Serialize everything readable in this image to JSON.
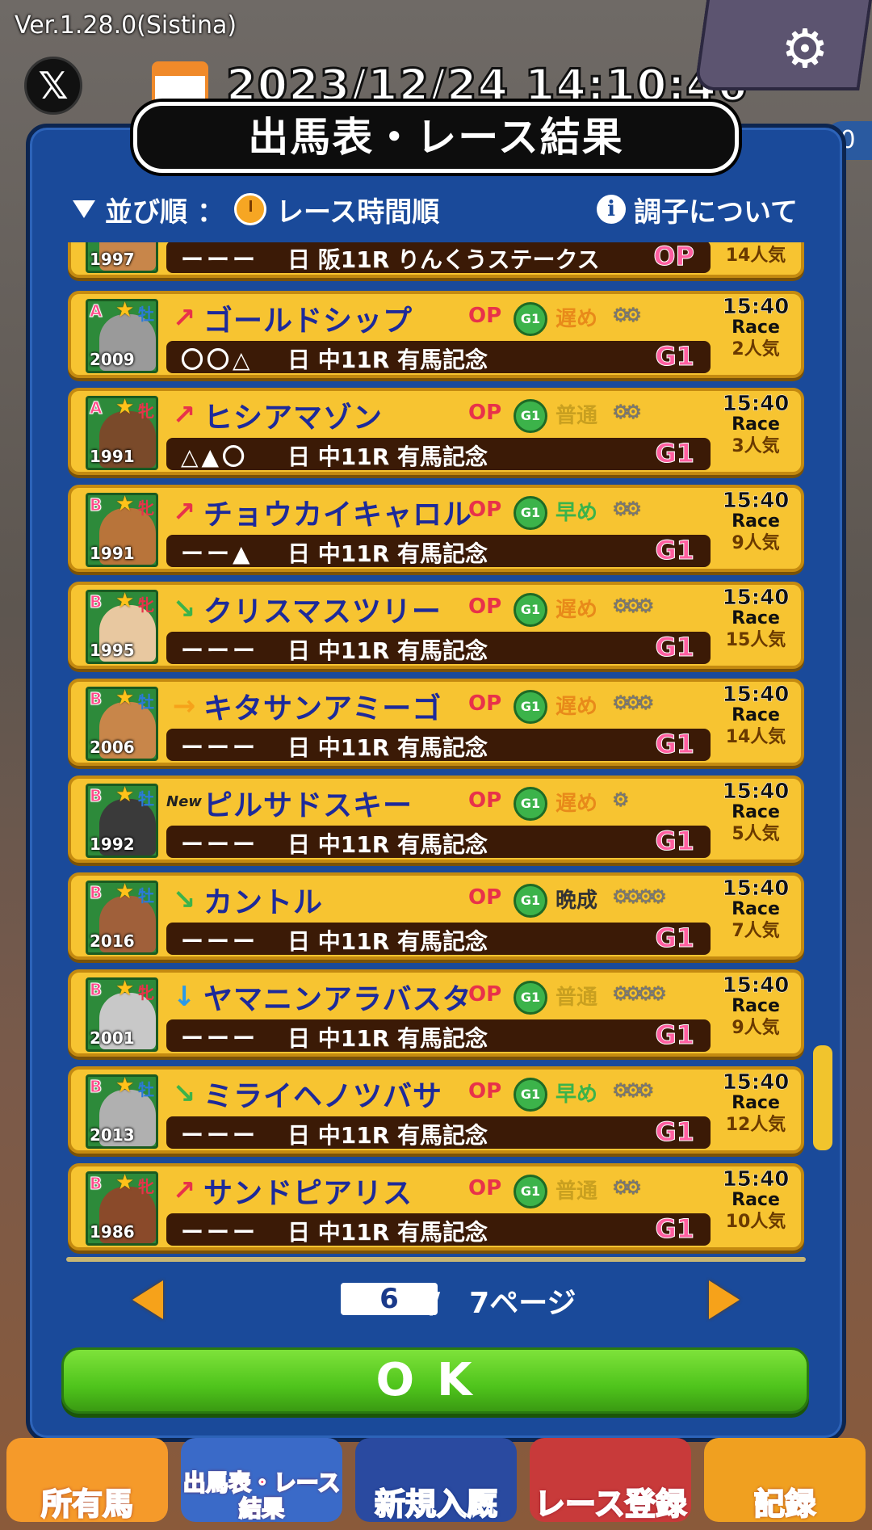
{
  "app": {
    "version": "Ver.1.28.0(Sistina)",
    "datetime": "2023/12/24 14:10:46",
    "x_label": "𝕏",
    "right_pill": "0"
  },
  "dialog": {
    "title": "出馬表・レース結果",
    "sort_prefix": "並び順",
    "sort_colon": "：",
    "sort_value": "レース時間順",
    "condition_link": "調子について"
  },
  "rows": [
    {
      "year": "2009",
      "grade": "A",
      "sex": "牡",
      "sex_color": "#2a7ad8",
      "trend": "↗",
      "trend_color": "#e8324a",
      "new": "",
      "name": "ゴールドシップ",
      "op": "OP",
      "g1": "G1",
      "growth": "遅め",
      "growth_color": "#e88a1a",
      "shoes": "⚙⚙",
      "marks": "〇〇△",
      "day": "日",
      "race": "中11R 有馬記念",
      "race_grade": "G1",
      "time": "15:40",
      "race_tag": "Race",
      "pop": "2人気",
      "coat": "#9a9a9a"
    },
    {
      "year": "1991",
      "grade": "A",
      "sex": "牝",
      "sex_color": "#e8324a",
      "trend": "↗",
      "trend_color": "#e8324a",
      "new": "",
      "name": "ヒシアマゾン",
      "op": "OP",
      "g1": "G1",
      "growth": "普通",
      "growth_color": "#c9a020",
      "shoes": "⚙⚙",
      "marks": "△▲〇",
      "day": "日",
      "race": "中11R 有馬記念",
      "race_grade": "G1",
      "time": "15:40",
      "race_tag": "Race",
      "pop": "3人気",
      "coat": "#7a4a2a"
    },
    {
      "year": "1991",
      "grade": "B",
      "sex": "牝",
      "sex_color": "#e8324a",
      "trend": "↗",
      "trend_color": "#e8324a",
      "new": "",
      "name": "チョウカイキャロル",
      "op": "OP",
      "g1": "G1",
      "growth": "早め",
      "growth_color": "#3cb34a",
      "shoes": "⚙⚙",
      "marks": "ーー▲",
      "day": "日",
      "race": "中11R 有馬記念",
      "race_grade": "G1",
      "time": "15:40",
      "race_tag": "Race",
      "pop": "9人気",
      "coat": "#b8743a"
    },
    {
      "year": "1995",
      "grade": "B",
      "sex": "牝",
      "sex_color": "#e8324a",
      "trend": "↘",
      "trend_color": "#3cb34a",
      "new": "",
      "name": "クリスマスツリー",
      "op": "OP",
      "g1": "G1",
      "growth": "遅め",
      "growth_color": "#e88a1a",
      "shoes": "⚙⚙⚙",
      "marks": "ーーー",
      "day": "日",
      "race": "中11R 有馬記念",
      "race_grade": "G1",
      "time": "15:40",
      "race_tag": "Race",
      "pop": "15人気",
      "coat": "#e8c8a0"
    },
    {
      "year": "2006",
      "grade": "B",
      "sex": "牡",
      "sex_color": "#2a7ad8",
      "trend": "→",
      "trend_color": "#f6a21a",
      "new": "",
      "name": "キタサンアミーゴ",
      "op": "OP",
      "g1": "G1",
      "growth": "遅め",
      "growth_color": "#e88a1a",
      "shoes": "⚙⚙⚙",
      "marks": "ーーー",
      "day": "日",
      "race": "中11R 有馬記念",
      "race_grade": "G1",
      "time": "15:40",
      "race_tag": "Race",
      "pop": "14人気",
      "coat": "#c8864a"
    },
    {
      "year": "1992",
      "grade": "B",
      "sex": "牡",
      "sex_color": "#2a7ad8",
      "trend": "",
      "trend_color": "#222",
      "new": "New",
      "name": "ピルサドスキー",
      "op": "OP",
      "g1": "G1",
      "growth": "遅め",
      "growth_color": "#e88a1a",
      "shoes": "⚙",
      "marks": "ーーー",
      "day": "日",
      "race": "中11R 有馬記念",
      "race_grade": "G1",
      "time": "15:40",
      "race_tag": "Race",
      "pop": "5人気",
      "coat": "#3a3a3a"
    },
    {
      "year": "2016",
      "grade": "B",
      "sex": "牡",
      "sex_color": "#2a7ad8",
      "trend": "↘",
      "trend_color": "#3cb34a",
      "new": "",
      "name": "カントル",
      "op": "OP",
      "g1": "G1",
      "growth": "晩成",
      "growth_color": "#333333",
      "shoes": "⚙⚙⚙⚙",
      "marks": "ーーー",
      "day": "日",
      "race": "中11R 有馬記念",
      "race_grade": "G1",
      "time": "15:40",
      "race_tag": "Race",
      "pop": "7人気",
      "coat": "#a0603a"
    },
    {
      "year": "2001",
      "grade": "B",
      "sex": "牝",
      "sex_color": "#e8324a",
      "trend": "↓",
      "trend_color": "#2a9ae8",
      "new": "",
      "name": "ヤマニンアラバスタ",
      "op": "OP",
      "g1": "G1",
      "growth": "普通",
      "growth_color": "#c9a020",
      "shoes": "⚙⚙⚙⚙",
      "marks": "ーーー",
      "day": "日",
      "race": "中11R 有馬記念",
      "race_grade": "G1",
      "time": "15:40",
      "race_tag": "Race",
      "pop": "9人気",
      "coat": "#c8c8c8"
    },
    {
      "year": "2013",
      "grade": "B",
      "sex": "牡",
      "sex_color": "#2a7ad8",
      "trend": "↘",
      "trend_color": "#3cb34a",
      "new": "",
      "name": "ミライヘノツバサ",
      "op": "OP",
      "g1": "G1",
      "growth": "早め",
      "growth_color": "#3cb34a",
      "shoes": "⚙⚙⚙",
      "marks": "ーーー",
      "day": "日",
      "race": "中11R 有馬記念",
      "race_grade": "G1",
      "time": "15:40",
      "race_tag": "Race",
      "pop": "12人気",
      "coat": "#b0b0b0"
    },
    {
      "year": "1986",
      "grade": "B",
      "sex": "牝",
      "sex_color": "#e8324a",
      "trend": "↗",
      "trend_color": "#e8324a",
      "new": "",
      "name": "サンドピアリス",
      "op": "OP",
      "g1": "G1",
      "growth": "普通",
      "growth_color": "#c9a020",
      "shoes": "⚙⚙",
      "marks": "ーーー",
      "day": "日",
      "race": "中11R 有馬記念",
      "race_grade": "G1",
      "time": "15:40",
      "race_tag": "Race",
      "pop": "10人気",
      "coat": "#8a4a2a"
    }
  ],
  "partial_top_row": {
    "year": "1997",
    "marks": "ーーー",
    "day": "日",
    "race": "阪11R りんくうステークス",
    "race_grade": "OP",
    "pop": "14人気"
  },
  "pagination": {
    "current": "6",
    "total": "/　7ページ"
  },
  "ok_label": "OK",
  "bottom_nav": [
    {
      "label": "所有馬"
    },
    {
      "label": "出馬表・レース結果"
    },
    {
      "label": "新規入厩"
    },
    {
      "label": "レース登録"
    },
    {
      "label": "記録"
    }
  ]
}
